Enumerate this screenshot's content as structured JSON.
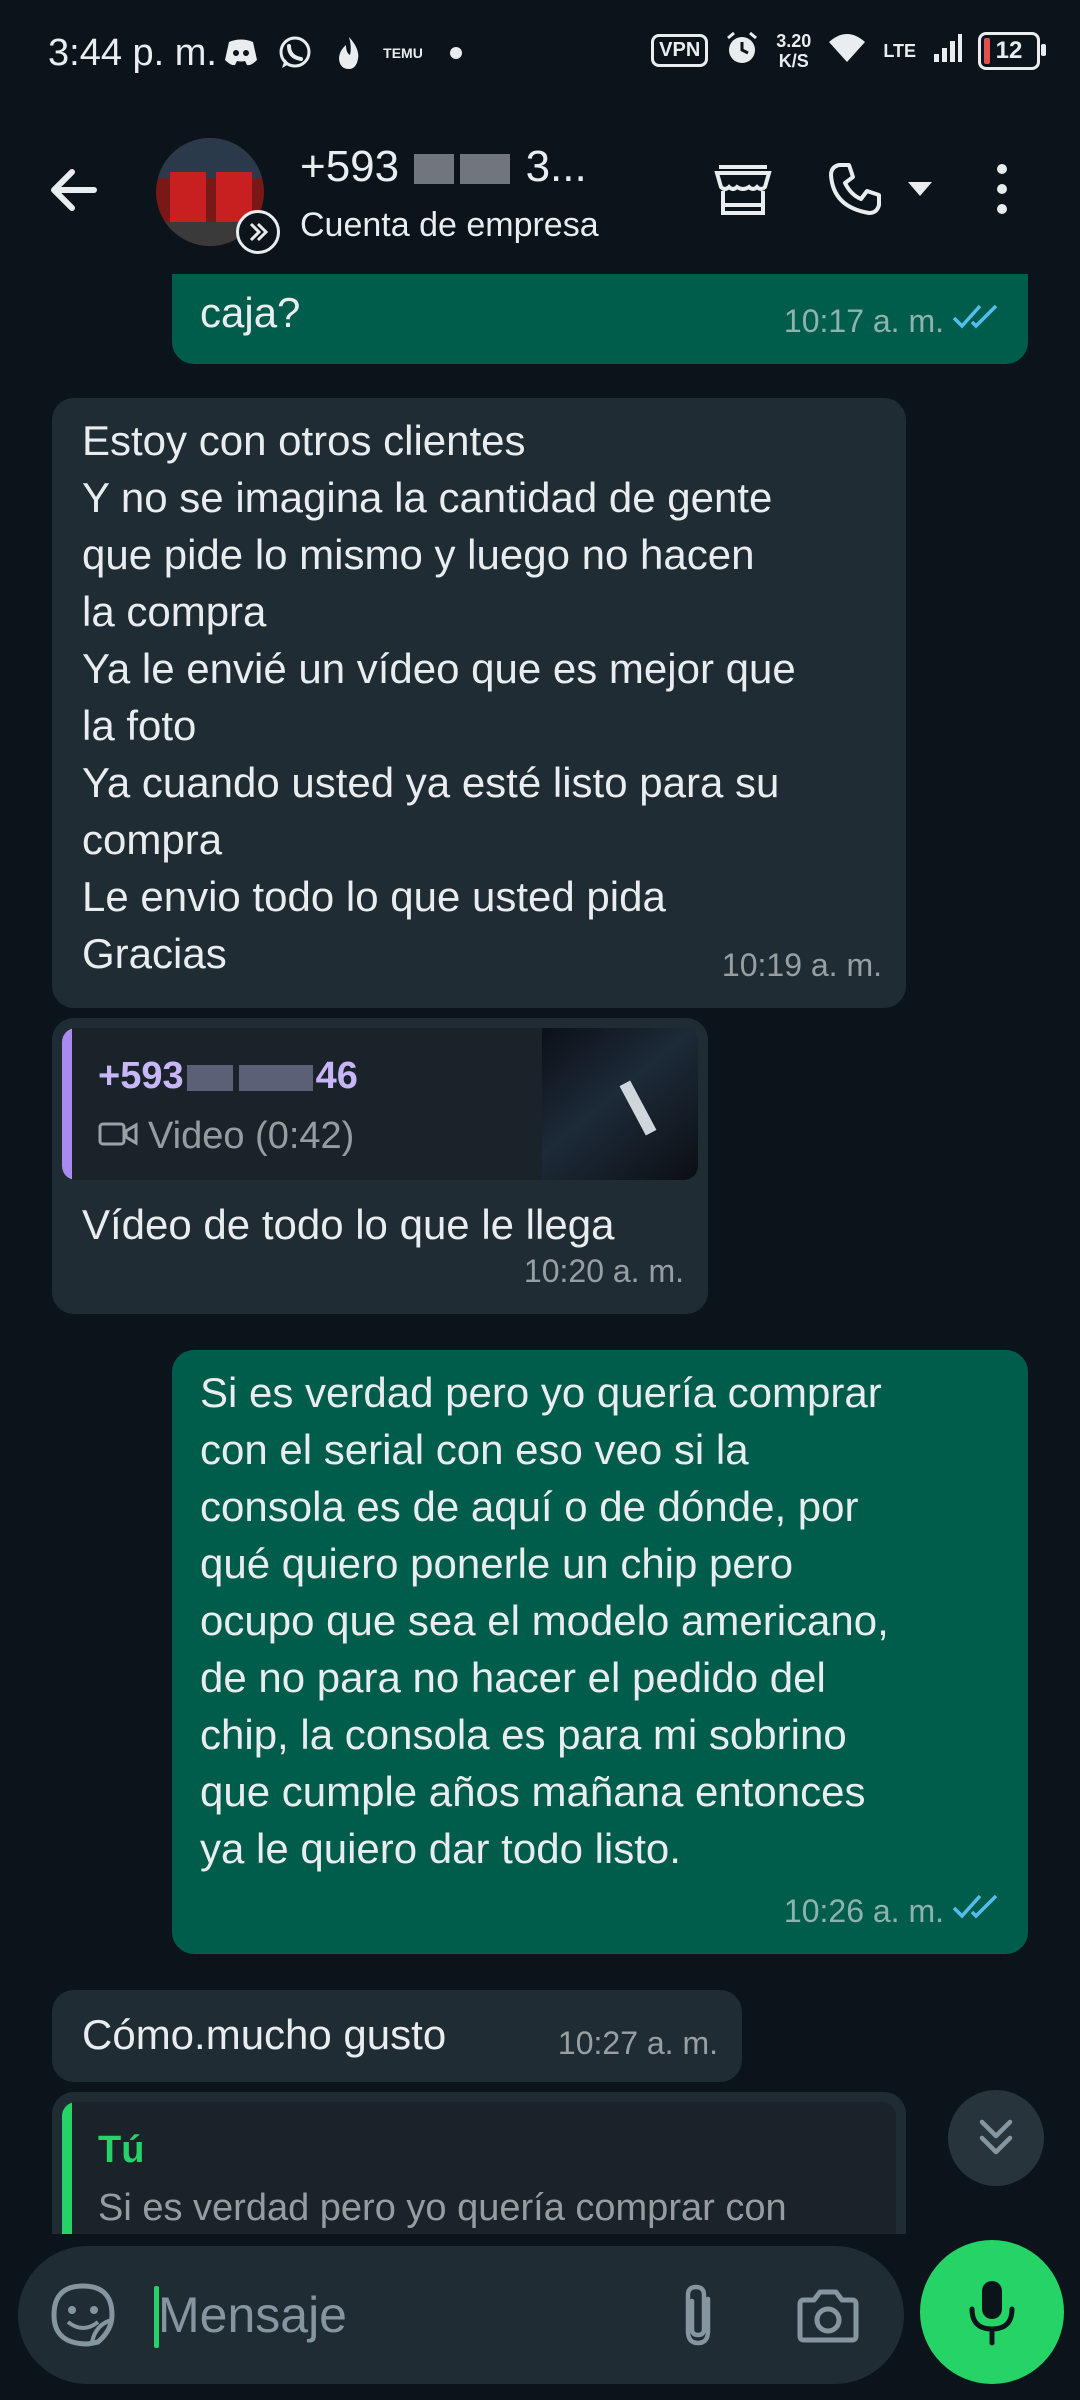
{
  "status_bar": {
    "time": "3:44 p. m.",
    "left_icons": [
      "discord-icon",
      "whatsapp-icon",
      "flame-icon",
      "temu-icon"
    ],
    "temu_label": "TEMU",
    "vpn_label": "VPN",
    "speed": "3.20",
    "speed_unit": "K/S",
    "network": "LTE",
    "battery": "12"
  },
  "header": {
    "contact_name_prefix": "+593",
    "contact_name_suffix": "3...",
    "subtitle": "Cuenta de empresa"
  },
  "messages": [
    {
      "direction": "out",
      "text": "caja?",
      "time": "10:17 a. m.",
      "status": "read"
    },
    {
      "direction": "in",
      "text": "Estoy con otros clientes\nY no se imagina la cantidad de gente\nque pide lo mismo y luego no hacen\nla compra\nYa le envié un vídeo que es mejor que\nla foto\nYa cuando usted ya esté listo para su\ncompra\nLe envio todo lo que usted pida\nGracias",
      "time": "10:19 a. m."
    },
    {
      "direction": "in",
      "quote_author": "+593",
      "quote_author_end": "46",
      "quote_text": "Video (0:42)",
      "text": "Vídeo de todo lo que le llega",
      "time": "10:20 a. m."
    },
    {
      "direction": "out",
      "text": "Si es verdad pero yo quería comprar\ncon el serial con eso veo si la\nconsola es de aquí o de dónde, por\nqué quiero ponerle un chip  pero\nocupo que sea el modelo americano,\nde no para no hacer el pedido del\nchip, la consola es para mi sobrino\nque cumple años mañana entonces\nya le quiero dar todo listo.",
      "time": "10:26 a. m.",
      "status": "read"
    },
    {
      "direction": "in",
      "text": "Cómo.mucho gusto",
      "time": "10:27 a. m."
    },
    {
      "direction": "in",
      "quote_author": "Tú",
      "quote_text": "Si es verdad pero yo quería comprar con"
    }
  ],
  "composer": {
    "placeholder": "Mensaje"
  },
  "colors": {
    "background": "#0b141a",
    "incoming_bubble": "#202c33",
    "outgoing_bubble": "#005c4b",
    "accent_green": "#25d366",
    "read_ticks": "#53bdeb",
    "quote_purple": "#a98bf0"
  }
}
